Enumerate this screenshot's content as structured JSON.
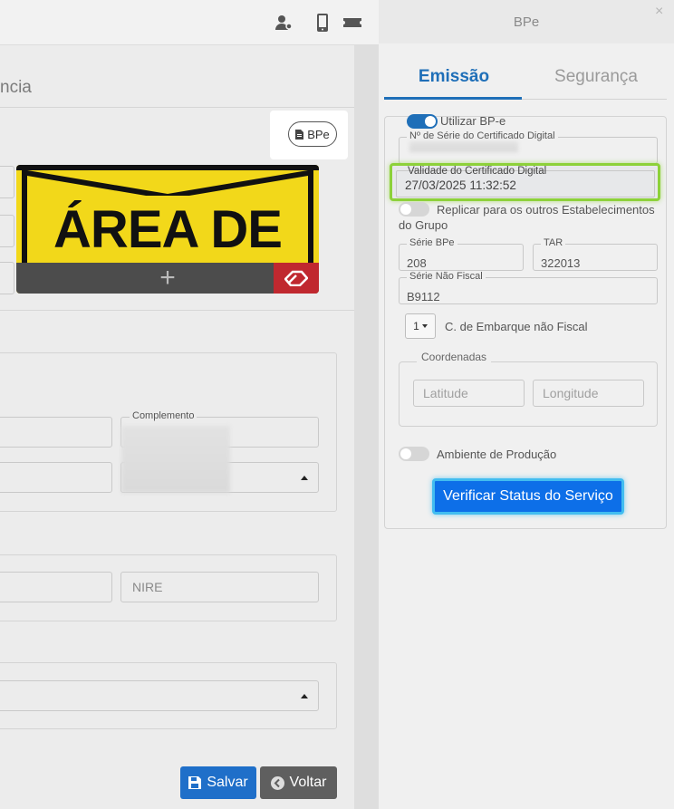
{
  "background": {
    "heading": "ncia",
    "bpe_button_label": "BPe",
    "image_text": "ÁREA DE",
    "complemento_label": "Complemento",
    "nire_placeholder": "NIRE",
    "save_label": "Salvar",
    "back_label": "Voltar"
  },
  "panel": {
    "title": "BPe",
    "close_glyph": "×",
    "tabs": [
      {
        "label": "Emissão",
        "active": true
      },
      {
        "label": "Segurança",
        "active": false
      }
    ],
    "utilizar_bpe_label": "Utilizar BP-e",
    "utilizar_bpe_on": true,
    "cert_serial_label": "Nº de Série do Certificado Digital",
    "cert_validity_label": "Validade do Certificado Digital",
    "cert_validity_value": "27/03/2025 11:32:52",
    "replicar_label": "Replicar para os outros Estabelecimentos do Grupo",
    "replicar_on": false,
    "serie_bpe_label": "Série BPe",
    "serie_bpe_value": "208",
    "tar_label": "TAR",
    "tar_value": "322013",
    "serie_nao_fiscal_label": "Série Não Fiscal",
    "serie_nao_fiscal_value": "B9112",
    "embarque_select_value": "1",
    "embarque_label": "C. de Embarque não Fiscal",
    "coordenadas_label": "Coordenadas",
    "latitude_placeholder": "Latitude",
    "longitude_placeholder": "Longitude",
    "ambiente_label": "Ambiente de Produção",
    "ambiente_on": false,
    "verify_button_label": "Verificar Status do Serviço"
  },
  "colors": {
    "accent": "#1f6fb8",
    "highlight_green": "#8dd13a",
    "verify_blue": "#0d6fe8"
  }
}
